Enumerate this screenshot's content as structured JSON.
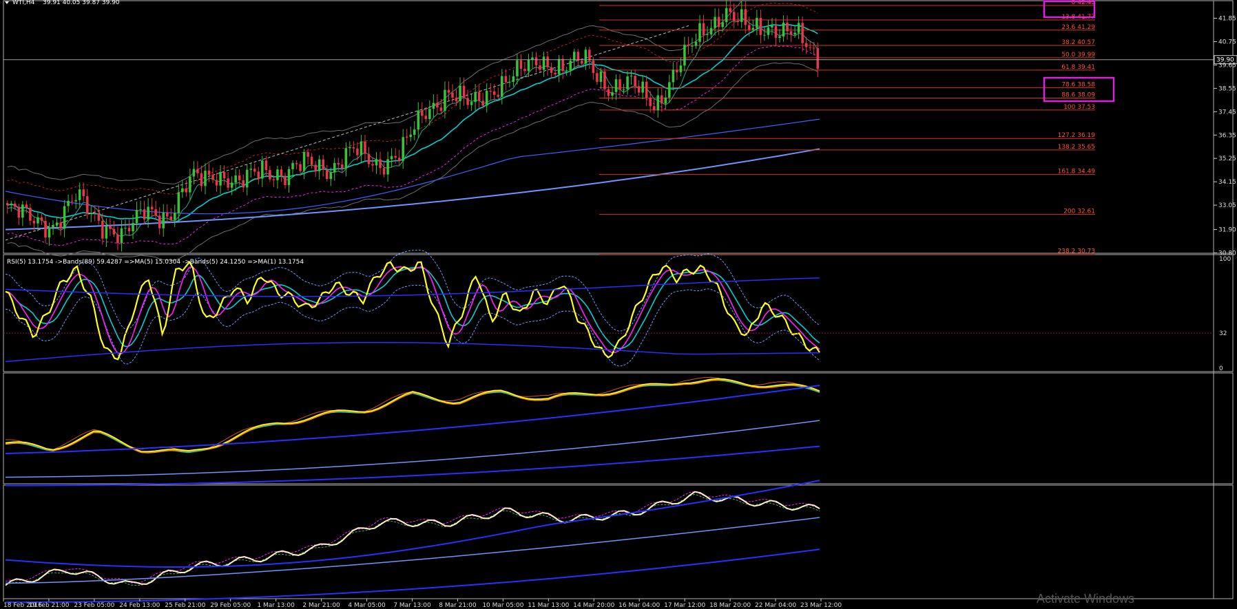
{
  "header": {
    "symbol": "WTI,H4",
    "ohlc": "39.91 40.05 39.87 39.90"
  },
  "watermark": "Activate Windows",
  "colors": {
    "background": "#000000",
    "bull": "#38c438",
    "bear": "#e8364a",
    "fib": "#d8361c",
    "fib_text": "#ff5233",
    "highlight_box": "#e020e0",
    "cyan": "#00d2d2",
    "blue": "#2830ff",
    "lightblue": "#7094ff",
    "yellow": "#ffff1e",
    "magenta": "#ff20ff",
    "grid": "#b4b4b4",
    "orange": "#ff8c00",
    "cream": "#fff0c8"
  },
  "chart_data": [
    {
      "type": "candlestick",
      "title": "WTI,H4",
      "ylim": [
        30.85,
        42.45
      ],
      "y_ticks": [
        "41.85",
        "40.75",
        "39.65",
        "38.55",
        "37.45",
        "36.35",
        "35.25",
        "34.15",
        "33.05",
        "31.90",
        "30.80"
      ],
      "last_price": "39.90",
      "fibonacci": [
        {
          "label": "0 42.45",
          "level": 42.45
        },
        {
          "label": "13.8 41.77",
          "level": 41.77
        },
        {
          "label": "23.6 41.29",
          "level": 41.29
        },
        {
          "label": "38.2 40.57",
          "level": 40.57
        },
        {
          "label": "50.0 39.99",
          "level": 39.99
        },
        {
          "label": "61.8 39.41",
          "level": 39.41
        },
        {
          "label": "78.6 38.58",
          "level": 38.58
        },
        {
          "label": "88.6 38.09",
          "level": 38.09
        },
        {
          "label": "100 37.53",
          "level": 37.53
        },
        {
          "label": "127.2 36.19",
          "level": 36.19
        },
        {
          "label": "138.2 35.65",
          "level": 35.65
        },
        {
          "label": "161.8 34.49",
          "level": 34.49
        },
        {
          "label": "200 32.61",
          "level": 32.61
        },
        {
          "label": "238.2 30.73",
          "level": 30.73
        }
      ],
      "price_path": [
        32.9,
        32.4,
        32.1,
        33.4,
        32.3,
        31.5,
        32.9,
        32.5,
        34.3,
        34.6,
        33.9,
        34.9,
        34.4,
        35.1,
        34.8,
        35.6,
        35.0,
        35.5,
        37.4,
        38.4,
        37.7,
        38.6,
        39.2,
        39.9,
        39.5,
        39.9,
        38.6,
        38.7,
        37.8,
        39.6,
        41.2,
        42.2,
        41.3,
        41.5,
        41.1,
        39.9
      ],
      "x_ticks": [
        "18 Feb 2016",
        "19 Feb 21:00",
        "23 Feb 05:00",
        "24 Feb 13:00",
        "25 Feb 21:00",
        "29 Feb 05:00",
        "1 Mar 13:00",
        "2 Mar 21:00",
        "4 Mar 05:00",
        "7 Mar 13:00",
        "8 Mar 21:00",
        "10 Mar 05:00",
        "11 Mar 13:00",
        "14 Mar 20:00",
        "16 Mar 04:00",
        "17 Mar 12:00",
        "18 Mar 20:00",
        "22 Mar 04:00",
        "23 Mar 12:00"
      ]
    },
    {
      "type": "line",
      "title": "RSI(5) 13.1754 ->Bands(89) 59.4287 =>MA(5) 15.0304 ->Bands(5) 24.1250 =>MA(1) 13.1754",
      "ylim": [
        0,
        100
      ],
      "y_ticks": [
        "100",
        "32",
        "0"
      ],
      "level": 32,
      "rsi_path": [
        70,
        48,
        30,
        52,
        80,
        90,
        62,
        15,
        10,
        55,
        85,
        30,
        92,
        95,
        42,
        55,
        74,
        62,
        86,
        70,
        65,
        55,
        62,
        77,
        70,
        62,
        85,
        95,
        88,
        97,
        55,
        22,
        52,
        88,
        42,
        68,
        48,
        70,
        60,
        80,
        48,
        28,
        10,
        22,
        50,
        76,
        94,
        82,
        90,
        90,
        70,
        40,
        30,
        58,
        50,
        36,
        22,
        13
      ]
    },
    {
      "type": "line",
      "series": [
        {
          "name": "",
          "values": [
            0.35,
            0.3,
            0.45,
            0.3,
            0.25,
            0.4,
            0.55,
            0.62,
            0.68,
            0.82,
            0.76,
            0.85,
            0.78,
            0.84,
            0.88,
            0.96,
            0.94,
            0.92,
            0.86
          ]
        }
      ]
    },
    {
      "type": "line",
      "series": [
        {
          "name": "",
          "values": [
            0.1,
            0.25,
            0.1,
            0.28,
            0.35,
            0.45,
            0.7,
            0.68,
            0.8,
            0.72,
            0.78,
            0.95,
            0.88,
            0.82
          ]
        }
      ]
    }
  ]
}
